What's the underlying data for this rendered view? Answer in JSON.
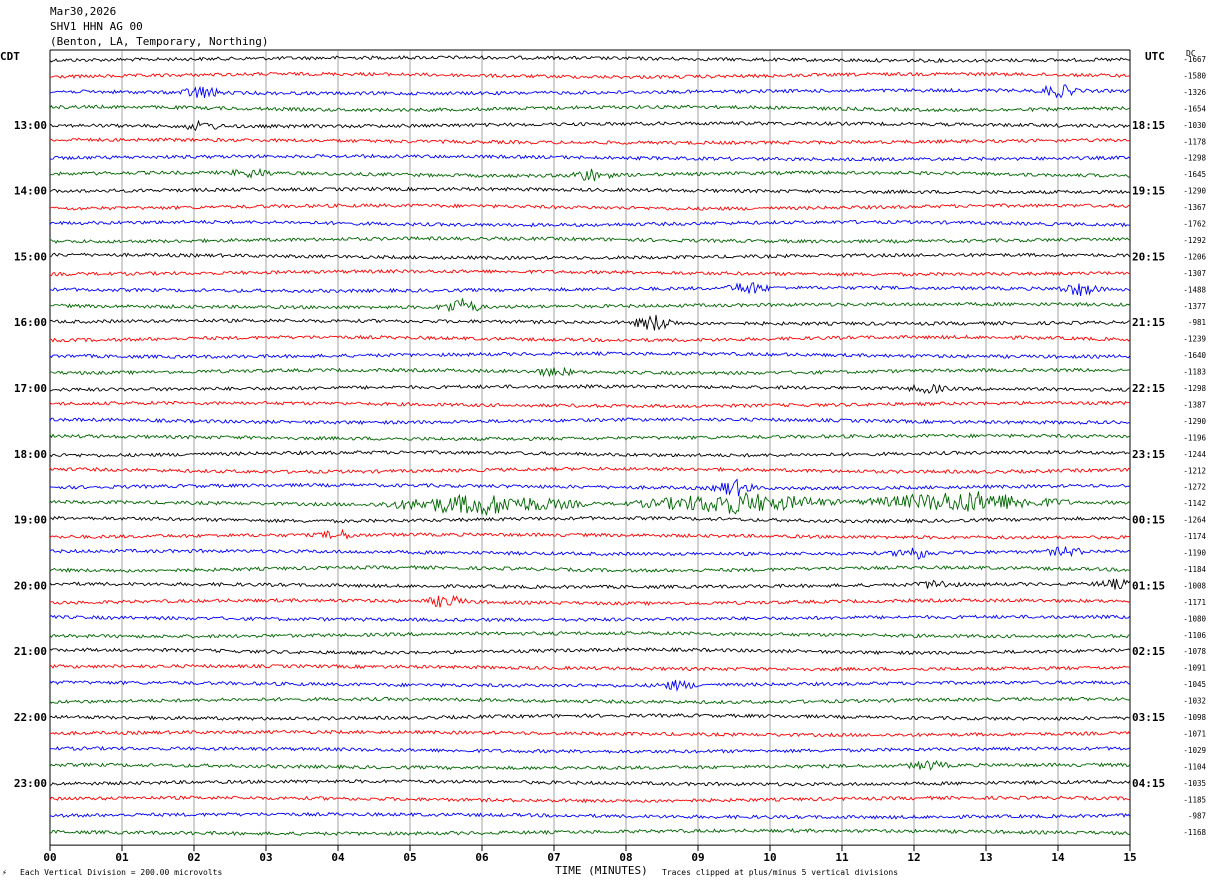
{
  "header": {
    "date": "Mar30,2026",
    "station": "SHV1 HHN AG 00",
    "location": "(Benton, LA, Temporary, Northing)"
  },
  "left_tz": "CDT",
  "right_tz": "UTC",
  "dc_label": "DC",
  "footer": {
    "scale_note": "Each Vertical Division =  200.00 microvolts",
    "xlabel": "TIME (MINUTES)",
    "clip_note": "Traces clipped at plus/minus 5 vertical divisions"
  },
  "chart_data": {
    "type": "line",
    "title": "",
    "xlabel": "TIME (MINUTES)",
    "xlim": [
      0,
      15
    ],
    "x_ticks": [
      "00",
      "01",
      "02",
      "03",
      "04",
      "05",
      "06",
      "07",
      "08",
      "09",
      "10",
      "11",
      "12",
      "13",
      "14",
      "15"
    ],
    "left_time_labels": [
      "13:00",
      "14:00",
      "15:00",
      "16:00",
      "17:00",
      "18:00",
      "19:00",
      "20:00",
      "21:00",
      "22:00",
      "23:00"
    ],
    "right_time_labels": [
      "18:15",
      "19:15",
      "20:15",
      "21:15",
      "22:15",
      "23:15",
      "00:15",
      "01:15",
      "02:15",
      "03:15",
      "04:15"
    ],
    "trace_colors": [
      "#000000",
      "#ff0000",
      "#0000ff",
      "#006600"
    ],
    "dc_offsets": [
      -1667,
      -1580,
      -1326,
      -1654,
      -1030,
      -1178,
      -1298,
      -1645,
      -1290,
      -1367,
      -1762,
      -1292,
      -1206,
      -1307,
      -1488,
      -1377,
      -981,
      -1239,
      -1640,
      -1183,
      -1298,
      -1387,
      -1290,
      -1196,
      -1244,
      -1212,
      -1272,
      -1142,
      -1264,
      -1174,
      -1190,
      -1184,
      -1008,
      -1171,
      -1080,
      -1106,
      -1078,
      -1091,
      -1045,
      -1032,
      -1098,
      -1071,
      -1029,
      -1104,
      -1035,
      -1185,
      -987,
      -1168
    ],
    "event_bursts": [
      {
        "trace": 2,
        "minute": 2.1,
        "strength": 3
      },
      {
        "trace": 2,
        "minute": 14.0,
        "strength": 3
      },
      {
        "trace": 4,
        "minute": 2.1,
        "strength": 2
      },
      {
        "trace": 7,
        "minute": 2.8,
        "strength": 2
      },
      {
        "trace": 7,
        "minute": 7.5,
        "strength": 3
      },
      {
        "trace": 14,
        "minute": 9.7,
        "strength": 3
      },
      {
        "trace": 14,
        "minute": 14.3,
        "strength": 3
      },
      {
        "trace": 15,
        "minute": 5.7,
        "strength": 4
      },
      {
        "trace": 16,
        "minute": 8.4,
        "strength": 4
      },
      {
        "trace": 19,
        "minute": 7.0,
        "strength": 2
      },
      {
        "trace": 20,
        "minute": 12.2,
        "strength": 2
      },
      {
        "trace": 26,
        "minute": 9.5,
        "strength": 4
      },
      {
        "trace": 27,
        "minute": 6.0,
        "strength": 5
      },
      {
        "trace": 27,
        "minute": 9.5,
        "strength": 5
      },
      {
        "trace": 27,
        "minute": 12.7,
        "strength": 5
      },
      {
        "trace": 29,
        "minute": 4.0,
        "strength": 2
      },
      {
        "trace": 30,
        "minute": 12.0,
        "strength": 3
      },
      {
        "trace": 30,
        "minute": 14.1,
        "strength": 2
      },
      {
        "trace": 32,
        "minute": 12.3,
        "strength": 2
      },
      {
        "trace": 32,
        "minute": 14.8,
        "strength": 2
      },
      {
        "trace": 33,
        "minute": 5.5,
        "strength": 3
      },
      {
        "trace": 38,
        "minute": 8.7,
        "strength": 2
      },
      {
        "trace": 43,
        "minute": 12.2,
        "strength": 2
      }
    ]
  }
}
